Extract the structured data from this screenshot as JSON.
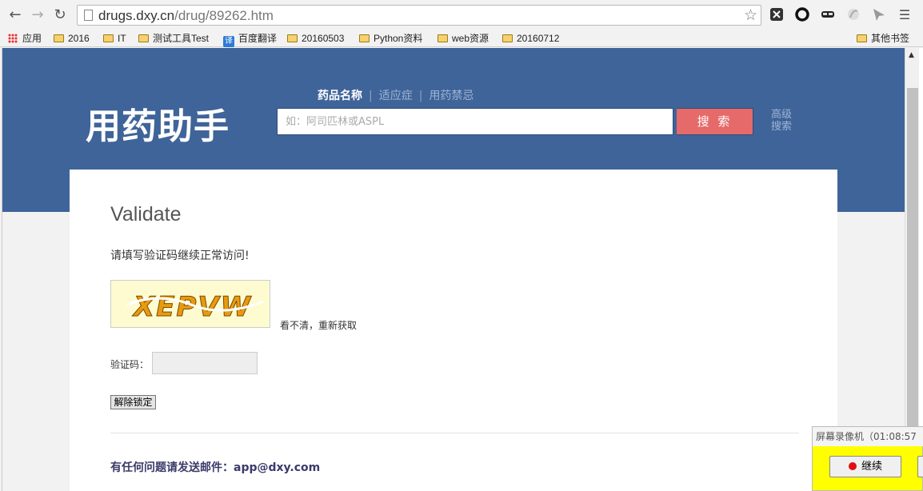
{
  "browser": {
    "url_host": "drugs.dxy.cn",
    "url_path": "/drug/89262.htm",
    "bookmarks": [
      {
        "label": "应用"
      },
      {
        "label": "2016"
      },
      {
        "label": "IT"
      },
      {
        "label": "测试工具Test"
      },
      {
        "label": "百度翻译"
      },
      {
        "label": "20160503"
      },
      {
        "label": "Python资料"
      },
      {
        "label": "web资源"
      },
      {
        "label": "20160712"
      }
    ],
    "other_bookmarks": "其他书签",
    "translate_badge": "译"
  },
  "header": {
    "logo": "用药助手",
    "tabs": [
      {
        "label": "药品名称"
      },
      {
        "label": "适应症"
      },
      {
        "label": "用药禁忌"
      }
    ],
    "tab_separator": "|",
    "search_placeholder": "如：阿司匹林或ASPL",
    "search_button": "搜 索",
    "advanced_search": "高级搜索"
  },
  "validate": {
    "title": "Validate",
    "message": "请填写验证码继续正常访问!",
    "captcha_text": "XEPVW",
    "refresh_link": "看不清，重新获取",
    "code_label": "验证码：",
    "unlock_button": "解除锁定",
    "contact": "有任何问题请发送邮件：app@dxy.com"
  },
  "recorder": {
    "title": "屏幕录像机（01:08:57",
    "continue_button": "继续"
  },
  "colors": {
    "banner": "#3f6499",
    "search_button": "#e66a6a",
    "recorder_bg": "#ffff00"
  }
}
